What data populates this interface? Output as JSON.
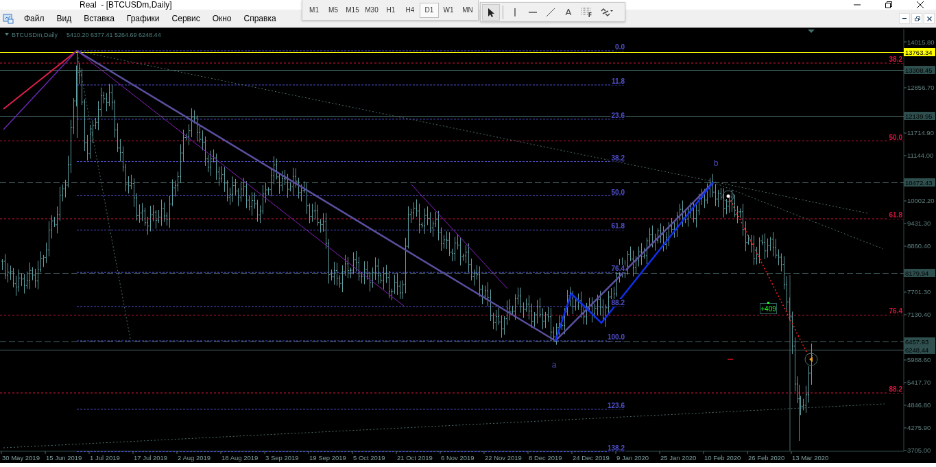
{
  "window": {
    "title": "Real  - [BTCUSDm,Daily]"
  },
  "menu": [
    "Файл",
    "Вид",
    "Вставка",
    "Графики",
    "Сервис",
    "Окно",
    "Справка"
  ],
  "timeframes": [
    {
      "label": "M1",
      "selected": false
    },
    {
      "label": "M5",
      "selected": false
    },
    {
      "label": "M15",
      "selected": false
    },
    {
      "label": "M30",
      "selected": false
    },
    {
      "label": "H1",
      "selected": false
    },
    {
      "label": "H4",
      "selected": false
    },
    {
      "label": "D1",
      "selected": true
    },
    {
      "label": "W1",
      "selected": false
    },
    {
      "label": "MN",
      "selected": false
    }
  ],
  "drawing_tools": [
    {
      "kind": "cursor",
      "selected": true
    },
    {
      "kind": "vline",
      "selected": false
    },
    {
      "kind": "hline",
      "selected": false
    },
    {
      "kind": "trendline",
      "selected": false
    },
    {
      "kind": "text",
      "label": "A",
      "selected": false
    },
    {
      "kind": "fibo",
      "label": "F",
      "selected": false
    },
    {
      "kind": "shapes",
      "selected": false
    }
  ],
  "chart": {
    "symbol": "BTCUSDm,Daily",
    "ohlc": "5410.20 6377.41 5264.69 6248.44",
    "price_ticks": [
      "14015.80",
      "12856.70",
      "11714.90",
      "11144.00",
      "10002.20",
      "9431.30",
      "8860.40",
      "7701.30",
      "7130.40",
      "5988.60",
      "5417.70",
      "4846.80",
      "4275.90",
      "3705.00"
    ],
    "price_tags": [
      {
        "price": "13763.34",
        "color": "#ffff00",
        "kind": "solid"
      },
      {
        "price": "13308.45",
        "color": "#2f4f4f",
        "kind": "solid"
      },
      {
        "price": "12139.95",
        "color": "#2f4f4f",
        "kind": "solid"
      },
      {
        "price": "10472.43",
        "color": "#2f4f4f",
        "kind": "dashed"
      },
      {
        "price": "8179.94",
        "color": "#2f4f4f",
        "kind": "dashed"
      },
      {
        "price": "6457.93",
        "color": "#2f4f4f",
        "kind": "dashed"
      },
      {
        "price": "6248.44",
        "color": "#2f4f4f",
        "kind": "solid"
      }
    ],
    "fibonacci": [
      {
        "color": "#5050d0",
        "levels": [
          "0.0",
          "11.8",
          "23.6",
          "38.2",
          "50.0",
          "61.8",
          "76.4",
          "88.2",
          "100.0",
          "123.6",
          "138.2"
        ]
      },
      {
        "color": "#dc143c",
        "levels": [
          "38.2",
          "50.0",
          "61.8",
          "76.4",
          "88.2"
        ]
      }
    ],
    "wave_labels": [
      "a",
      "b"
    ],
    "profit_label": "+409",
    "date_labels": [
      "30 May 2019",
      "15 Jun 2019",
      "1 Jul 2019",
      "17 Jul 2019",
      "2 Aug 2019",
      "18 Aug 2019",
      "3 Sep 2019",
      "19 Sep 2019",
      "5 Oct 2019",
      "21 Oct 2019",
      "6 Nov 2019",
      "22 Nov 2019",
      "8 Dec 2019",
      "24 Dec 2019",
      "9 Jan 2020",
      "25 Jan 2020",
      "10 Feb 2020",
      "26 Feb 2020",
      "13 Mar 2020"
    ]
  }
}
